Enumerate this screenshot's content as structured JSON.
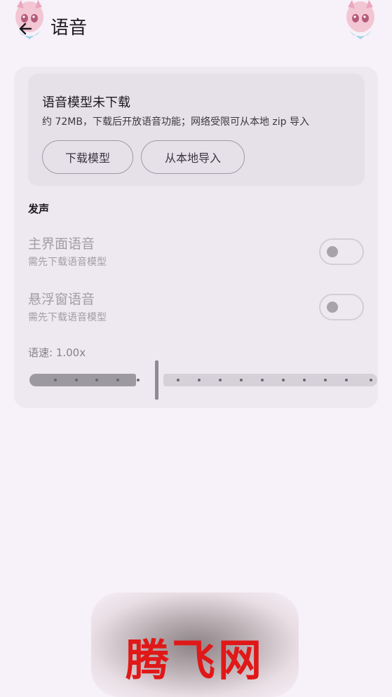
{
  "header": {
    "title": "语音"
  },
  "model_card": {
    "title": "语音模型未下载",
    "description": "约 72MB，下载后开放语音功能；网络受限可从本地 zip 导入",
    "download_button": "下载模型",
    "import_button": "从本地导入"
  },
  "voice_section": {
    "label": "发声",
    "settings": [
      {
        "title": "主界面语音",
        "subtitle": "需先下载语音模型",
        "enabled": false
      },
      {
        "title": "悬浮窗语音",
        "subtitle": "需先下载语音模型",
        "enabled": false
      }
    ],
    "speed_label": "语速: 1.00x",
    "speed_slider": {
      "min_steps": 16,
      "active_steps": 5,
      "value_fraction": 0.32
    }
  },
  "watermark": {
    "text": "腾飞网"
  },
  "icons": {
    "back": "arrow-left-icon",
    "decoration": "anime-character-icon"
  },
  "colors": {
    "background": "#f7f1f9",
    "card": "#eee8f0",
    "watermark_red": "#e01818"
  }
}
